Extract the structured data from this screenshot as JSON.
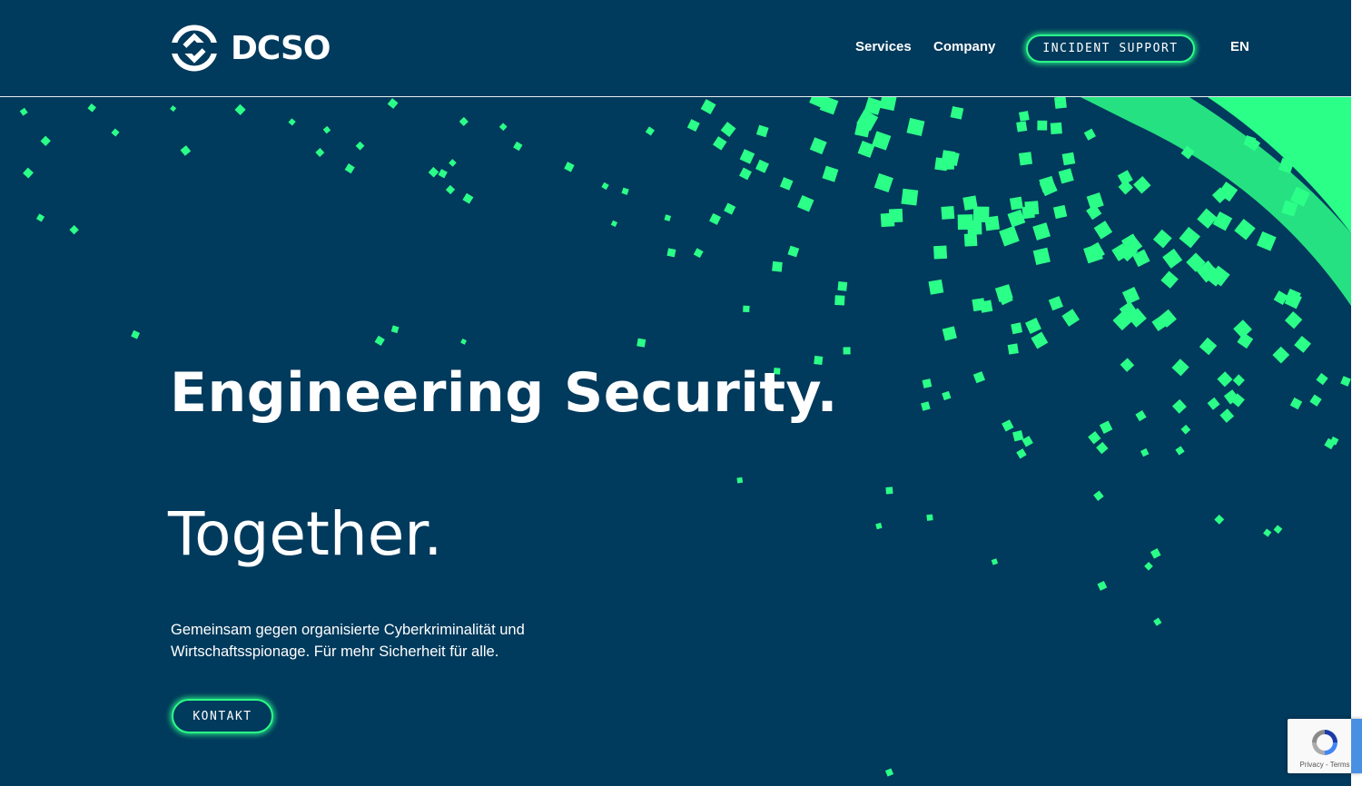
{
  "brand": {
    "name": "DCSO",
    "accent_color": "#2bff88",
    "background_color": "#003a5c",
    "text_color": "#ffffff"
  },
  "nav": {
    "services": "Services",
    "company": "Company",
    "incident_support": "INCIDENT SUPPORT",
    "language": "EN"
  },
  "hero": {
    "title": "Engineering Security.",
    "subtitle": "Together.",
    "text": "Gemeinsam gegen organisierte Cyberkriminalität und Wirtschaftsspionage. Für mehr Sicherheit für alle.",
    "cta": "KONTAKT"
  },
  "recaptcha": {
    "links": "Privacy - Terms",
    "icon": "recaptcha-icon"
  }
}
